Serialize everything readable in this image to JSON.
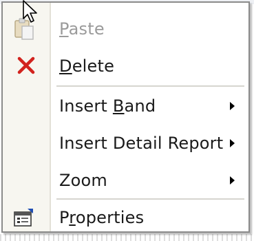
{
  "menu": {
    "items": [
      {
        "label_pre": "",
        "mnemonic": "P",
        "label_post": "aste",
        "disabled": true
      },
      {
        "label_pre": "",
        "mnemonic": "D",
        "label_post": "elete"
      },
      {
        "label_pre": "Insert ",
        "mnemonic": "B",
        "label_post": "and"
      },
      {
        "label": "Insert Detail Report"
      },
      {
        "label": "Zoom"
      },
      {
        "label_pre": "P",
        "mnemonic": "r",
        "label_post": "operties"
      }
    ]
  },
  "icons": {
    "paste": "paste-icon",
    "delete": "delete-x-icon",
    "properties": "properties-icon",
    "submenu": "submenu-arrow-icon",
    "cursor": "mouse-pointer-icon"
  },
  "colors": {
    "delete_red": "#d2231e",
    "disabled_text": "#9b9b9b",
    "gutter": "#f7f6f0"
  }
}
